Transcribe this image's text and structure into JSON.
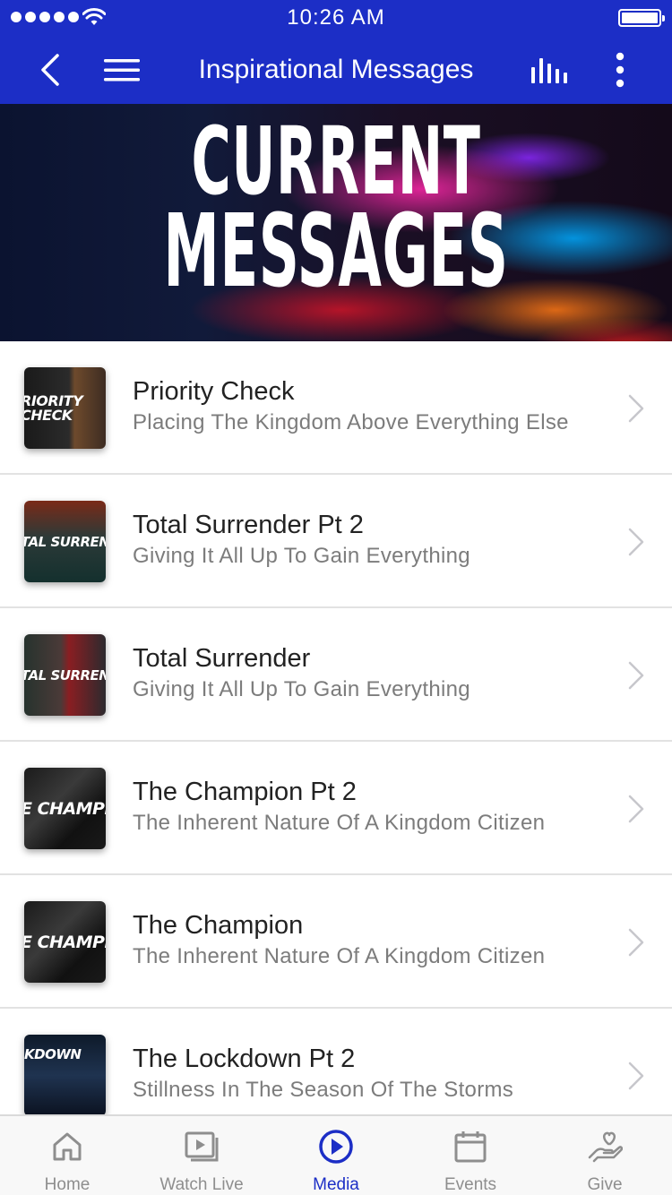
{
  "status_bar": {
    "time": "10:26 AM"
  },
  "nav": {
    "title": "Inspirational Messages",
    "icons": [
      "chevron-left-icon",
      "hamburger-menu-icon",
      "equalizer-icon",
      "more-vertical-icon"
    ]
  },
  "hero": {
    "line1": "CURRENT",
    "line2": "MESSAGES"
  },
  "messages": [
    {
      "title": "Priority Check",
      "subtitle": "Placing The Kingdom Above Everything Else",
      "thumb_text": "RIORITY\nCHECK"
    },
    {
      "title": "Total Surrender Pt 2",
      "subtitle": "Giving It All Up To Gain Everything",
      "thumb_text": "TAL SURREND"
    },
    {
      "title": "Total Surrender",
      "subtitle": "Giving It All Up To Gain Everything",
      "thumb_text": "TAL SURREND"
    },
    {
      "title": "The Champion Pt 2",
      "subtitle": "The Inherent Nature Of A Kingdom Citizen",
      "thumb_text": "E CHAMPIC"
    },
    {
      "title": "The Champion",
      "subtitle": "The Inherent Nature Of A Kingdom Citizen",
      "thumb_text": "E CHAMPIC"
    },
    {
      "title": "The Lockdown Pt 2",
      "subtitle": "Stillness In The Season Of The Storms",
      "thumb_text": "KDOWN"
    }
  ],
  "tabs": [
    {
      "label": "Home",
      "icon": "home-icon"
    },
    {
      "label": "Watch Live",
      "icon": "video-icon"
    },
    {
      "label": "Media",
      "icon": "play-circle-icon",
      "active": true
    },
    {
      "label": "Events",
      "icon": "calendar-icon"
    },
    {
      "label": "Give",
      "icon": "give-hand-heart-icon"
    }
  ],
  "colors": {
    "brand": "#1c2ec6",
    "tab_inactive": "#8e8e8e",
    "subtitle": "#7c7c7c"
  }
}
